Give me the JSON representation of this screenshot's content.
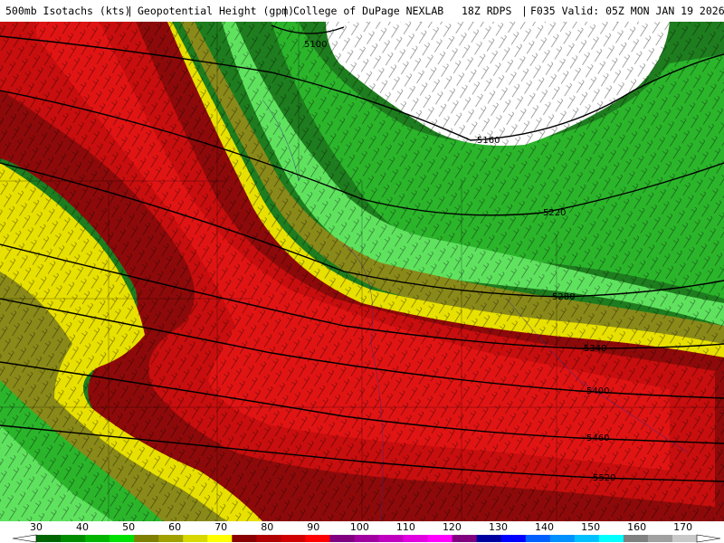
{
  "header": {
    "product": "500mb Isotachs (kts)",
    "field": "Geopotential Height (gpm)",
    "source": "College of DuPage NEXLAB",
    "model": "18Z RDPS",
    "forecast": "F035 Valid: 05Z MON JAN 19 2026"
  },
  "contours": [
    {
      "label": "5100"
    },
    {
      "label": "5160"
    },
    {
      "label": "5220"
    },
    {
      "label": "5280"
    },
    {
      "label": "5340"
    },
    {
      "label": "5400"
    },
    {
      "label": "5460"
    },
    {
      "label": "5520"
    }
  ],
  "colorbar": {
    "ticks": [
      "30",
      "40",
      "50",
      "60",
      "70",
      "80",
      "90",
      "100",
      "110",
      "120",
      "130",
      "140",
      "150",
      "160",
      "170"
    ],
    "colors": [
      "#006400",
      "#008c00",
      "#00b400",
      "#00e000",
      "#808000",
      "#a0a000",
      "#d8d800",
      "#ffff00",
      "#8b0000",
      "#b00000",
      "#d00000",
      "#ff0000",
      "#800080",
      "#a000a0",
      "#c000c0",
      "#e000e0",
      "#ff00ff",
      "#800080",
      "#0000a0",
      "#0000ff",
      "#0060ff",
      "#0090ff",
      "#00c0ff",
      "#00ffff",
      "#808080",
      "#a0a0a0",
      "#c8c8c8"
    ]
  },
  "legend_colors": {
    "calm": "#ffffff",
    "dark_green": "#1e7d1e",
    "green": "#2bb52b",
    "lime": "#5fe35f",
    "olive": "#8a8a1a",
    "yellow": "#e8e000",
    "dark_red": "#8e0a0a",
    "red": "#c80e0e",
    "bright_red": "#e11414"
  }
}
